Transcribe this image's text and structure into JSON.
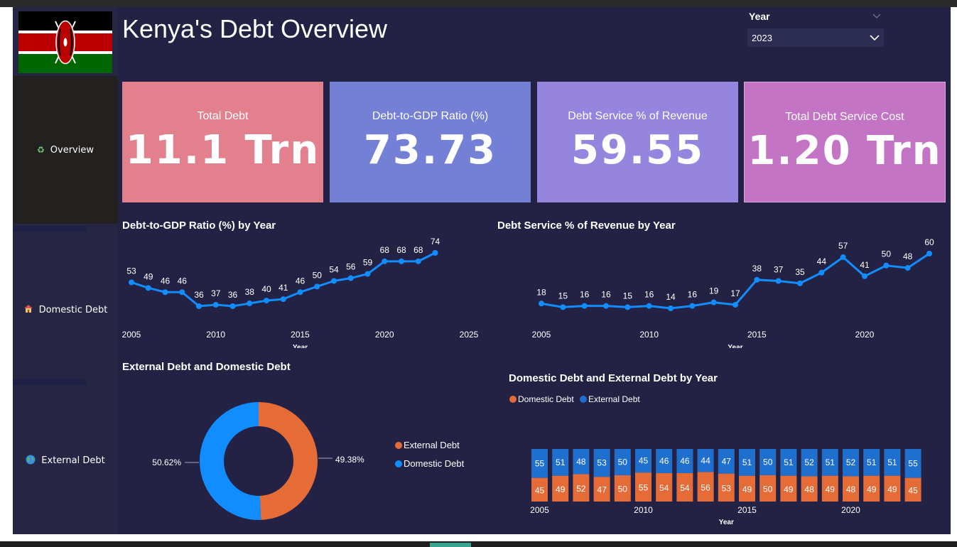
{
  "header": {
    "title": "Kenya's Debt Overview"
  },
  "slicer": {
    "label": "Year",
    "selected": "2023"
  },
  "nav": {
    "overview": "Overview",
    "domestic": "Domestic Debt",
    "external": "External Debt"
  },
  "kpis": [
    {
      "label": "Total Debt",
      "value": "11.1 Trn"
    },
    {
      "label": "Debt-to-GDP Ratio (%)",
      "value": "73.73"
    },
    {
      "label": "Debt Service % of Revenue",
      "value": "59.55"
    },
    {
      "label": "Total Debt Service Cost",
      "value": "1.20 Trn"
    }
  ],
  "colors": {
    "line": "#118dff",
    "domestic": "#e66c37",
    "external": "#118dff",
    "bar_external": "#1f6fcf",
    "bg": "#242244"
  },
  "chart_data": [
    {
      "type": "line",
      "title": "Debt-to-GDP Ratio (%) by Year",
      "xlabel": "Year",
      "x": [
        2005,
        2006,
        2007,
        2008,
        2009,
        2010,
        2011,
        2012,
        2013,
        2014,
        2015,
        2016,
        2017,
        2018,
        2019,
        2020,
        2021,
        2022,
        2023
      ],
      "values": [
        53,
        49,
        46,
        46,
        36,
        37,
        36,
        38,
        40,
        41,
        46,
        50,
        54,
        56,
        59,
        68,
        68,
        68,
        74
      ],
      "xticks": [
        2005,
        2010,
        2015,
        2020,
        2025
      ],
      "xlim": [
        2005,
        2025
      ]
    },
    {
      "type": "line",
      "title": "Debt Service % of Revenue by Year",
      "xlabel": "Year",
      "x": [
        2005,
        2006,
        2007,
        2008,
        2009,
        2010,
        2011,
        2012,
        2013,
        2014,
        2015,
        2016,
        2017,
        2018,
        2019,
        2020,
        2021,
        2022,
        2023
      ],
      "values": [
        18,
        15,
        16,
        16,
        15,
        16,
        14,
        16,
        19,
        17,
        38,
        37,
        35,
        44,
        57,
        41,
        50,
        48,
        60
      ],
      "xticks": [
        2005,
        2010,
        2015,
        2020
      ],
      "xlim": [
        2005,
        2023
      ]
    },
    {
      "type": "pie",
      "title": "External Debt and Domestic Debt",
      "labels": [
        "External Debt",
        "Domestic Debt"
      ],
      "values": [
        49.38,
        50.62
      ],
      "value_labels": [
        "49.38%",
        "50.62%"
      ]
    },
    {
      "type": "bar",
      "title": "Domestic Debt and External Debt by Year",
      "xlabel": "Year",
      "categories": [
        2005,
        2006,
        2007,
        2008,
        2009,
        2010,
        2011,
        2012,
        2013,
        2014,
        2015,
        2016,
        2017,
        2018,
        2019,
        2020,
        2021,
        2022,
        2023
      ],
      "xticks": [
        2005,
        2010,
        2015,
        2020
      ],
      "series": [
        {
          "name": "Domestic Debt",
          "values": [
            45,
            49,
            52,
            47,
            50,
            55,
            54,
            54,
            56,
            53,
            49,
            50,
            49,
            48,
            49,
            48,
            49,
            49,
            45
          ]
        },
        {
          "name": "External Debt",
          "values": [
            55,
            51,
            48,
            53,
            50,
            45,
            46,
            46,
            44,
            47,
            51,
            50,
            51,
            52,
            51,
            52,
            51,
            51,
            55
          ]
        }
      ],
      "stacked_percent": true
    }
  ]
}
